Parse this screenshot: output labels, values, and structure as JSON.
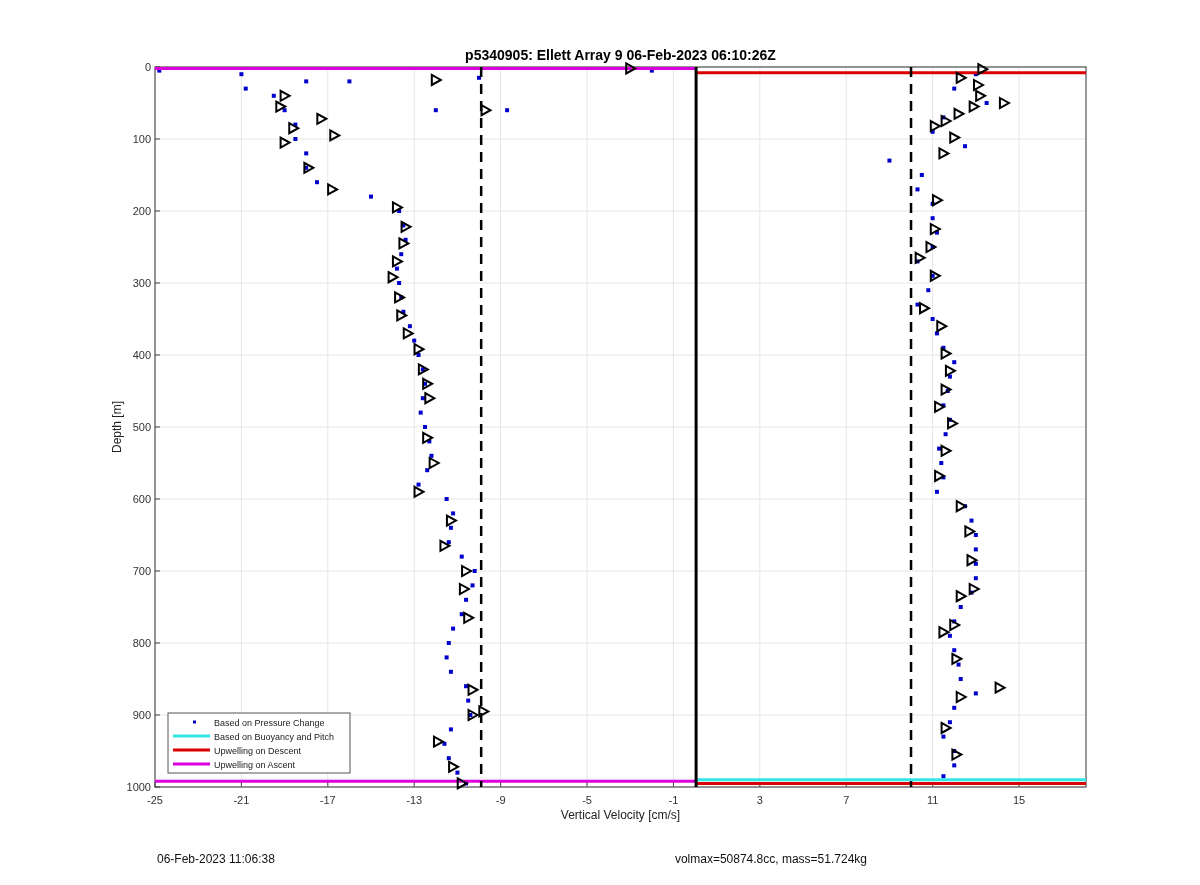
{
  "figure": {
    "chart_data": {
      "type": "scatter",
      "title": "p5340905: Ellett Array 9 06-Feb-2023 06:10:26Z",
      "xlabel": "Vertical Velocity [cm/s]",
      "ylabel": "Depth [m]",
      "xlim": [
        -25,
        18.1
      ],
      "ylim": [
        1000,
        0
      ],
      "xticks": [
        -25,
        -21,
        -17,
        -13,
        -9,
        -5,
        -1,
        3,
        7,
        11,
        15
      ],
      "yticks": [
        0,
        100,
        200,
        300,
        400,
        500,
        600,
        700,
        800,
        900,
        1000
      ],
      "grid": true,
      "legend": true,
      "series": [
        {
          "name": "Based on Pressure Change",
          "color": "#0000cc",
          "marker": "square",
          "x": [
            -24.8,
            -21,
            -20.8,
            -10,
            -8.7,
            -12,
            -16,
            -2,
            -18,
            -19.5,
            -19,
            -18.5,
            -18.5,
            -18,
            -18,
            -17.5,
            -15,
            -13.7,
            -13.5,
            -13.4,
            -13.6,
            -13.8,
            -13.7,
            -13.6,
            -13.5,
            -13.2,
            -13,
            -12.8,
            -12.6,
            -12.5,
            -12.6,
            -12.7,
            -12.5,
            -12.3,
            -12.2,
            -12.4,
            -12.8,
            -11.5,
            -11.2,
            -11.3,
            -11.4,
            -10.8,
            -10.2,
            -10.3,
            -10.6,
            -10.8,
            -11.2,
            -11.4,
            -11.5,
            -11.3,
            -10.6,
            -10.5,
            -10.4,
            -11.3,
            -11.6,
            -11.4,
            -11,
            -10.6,
            13,
            12,
            13.5,
            11.5,
            11,
            12.5,
            9,
            10.5,
            10.3,
            11,
            11,
            11.2,
            11,
            10.3,
            11,
            10.8,
            10.3,
            11,
            11.2,
            11.5,
            12,
            11.8,
            11.7,
            11.5,
            11.8,
            11.6,
            11.3,
            11.4,
            11.5,
            11.2,
            12.5,
            12.8,
            13,
            13,
            13,
            13,
            12.8,
            12.3,
            12,
            11.8,
            12,
            12.2,
            12.3,
            13,
            12,
            11.8,
            11.5,
            12,
            12,
            11.5
          ],
          "values": [
            5,
            10,
            30,
            15,
            60,
            60,
            20,
            5,
            20,
            40,
            60,
            80,
            100,
            120,
            140,
            160,
            180,
            200,
            220,
            240,
            260,
            280,
            300,
            320,
            340,
            360,
            380,
            400,
            420,
            440,
            460,
            480,
            500,
            520,
            540,
            560,
            580,
            600,
            620,
            640,
            660,
            680,
            700,
            720,
            740,
            760,
            780,
            800,
            820,
            840,
            860,
            880,
            900,
            920,
            940,
            960,
            980,
            995,
            10,
            30,
            50,
            70,
            90,
            110,
            130,
            150,
            170,
            190,
            210,
            230,
            250,
            270,
            290,
            310,
            330,
            350,
            370,
            390,
            410,
            430,
            450,
            470,
            490,
            510,
            530,
            550,
            570,
            590,
            610,
            630,
            650,
            670,
            690,
            710,
            730,
            750,
            770,
            790,
            810,
            830,
            850,
            870,
            890,
            910,
            930,
            950,
            970,
            985
          ]
        },
        {
          "color": "#000000",
          "marker": "triangle",
          "x": [
            -3,
            -12,
            -19,
            -19.2,
            -17.3,
            -18.6,
            -16.7,
            -19,
            -17.9,
            -16.8,
            -13.8,
            -13.4,
            -13.5,
            -13.8,
            -14,
            -13.7,
            -13.6,
            -13.3,
            -12.8,
            -12.6,
            -12.4,
            -12.3,
            -12.4,
            -12.1,
            -12.8,
            -11.3,
            -11.6,
            -10.6,
            -10.7,
            -10.5,
            -10.3,
            -9.8,
            -10.3,
            -11.9,
            -11.2,
            -10.8,
            -9.7,
            13.3,
            12.3,
            13.1,
            13.2,
            14.3,
            12.9,
            12.2,
            11.6,
            11.1,
            12,
            11.5,
            11.2,
            11.1,
            10.9,
            10.4,
            11.1,
            10.6,
            11.4,
            11.6,
            11.8,
            11.6,
            11.3,
            11.9,
            11.6,
            11.3,
            12.3,
            12.7,
            12.8,
            12.9,
            12.3,
            11.5,
            12,
            12.1,
            12.3,
            14.1,
            11.6,
            12.1
          ],
          "values": [
            2,
            18,
            40,
            55,
            72,
            85,
            95,
            105,
            140,
            170,
            195,
            222,
            245,
            270,
            292,
            320,
            345,
            370,
            392,
            420,
            440,
            460,
            515,
            550,
            590,
            630,
            665,
            700,
            725,
            765,
            865,
            895,
            900,
            937,
            972,
            995,
            60,
            3,
            15,
            25,
            40,
            50,
            55,
            65,
            75,
            82,
            98,
            120,
            185,
            225,
            250,
            265,
            290,
            335,
            360,
            398,
            422,
            448,
            472,
            495,
            533,
            568,
            610,
            645,
            685,
            725,
            735,
            785,
            775,
            822,
            875,
            862,
            918,
            955
          ]
        },
        {
          "name": "Based on Buoyancy and Pitch",
          "color": "#33e6e6",
          "type": "line",
          "marker": "none",
          "x": [
            0.05,
            18.1
          ],
          "values": [
            990,
            990
          ]
        },
        {
          "name": "Upwelling on Descent",
          "color": "#dd0000",
          "type": "line",
          "marker": "none",
          "x": [
            0.05,
            18.1
          ],
          "values": [
            8,
            8
          ]
        },
        {
          "name": "Upwelling on Ascent",
          "color": "#dd00dd",
          "type": "line",
          "marker": "none",
          "x": [
            -25,
            0.05
          ],
          "values": [
            2,
            2
          ]
        },
        {
          "color": "#dd0000",
          "type": "line",
          "marker": "none",
          "x": [
            0.05,
            18.1
          ],
          "values": [
            995,
            995
          ]
        },
        {
          "color": "#dd00dd",
          "type": "line",
          "marker": "none",
          "x": [
            -25,
            0.05
          ],
          "values": [
            992,
            992
          ]
        },
        {
          "color": "#000000",
          "type": "line",
          "marker": "none",
          "x": [
            0.05,
            0.05
          ],
          "values": [
            0,
            1000
          ]
        },
        {
          "color": "#000000",
          "type": "line",
          "marker": "none",
          "line_style": "dashed",
          "x": [
            -9.9,
            -9.9
          ],
          "values": [
            0,
            1000
          ]
        },
        {
          "color": "#000000",
          "type": "line",
          "marker": "none",
          "line_style": "dashed",
          "x": [
            10,
            10
          ],
          "values": [
            0,
            1000
          ]
        }
      ]
    }
  },
  "footer": {
    "left": "06-Feb-2023 11:06:38",
    "right": "volmax=50874.8cc, mass=51.724kg"
  }
}
